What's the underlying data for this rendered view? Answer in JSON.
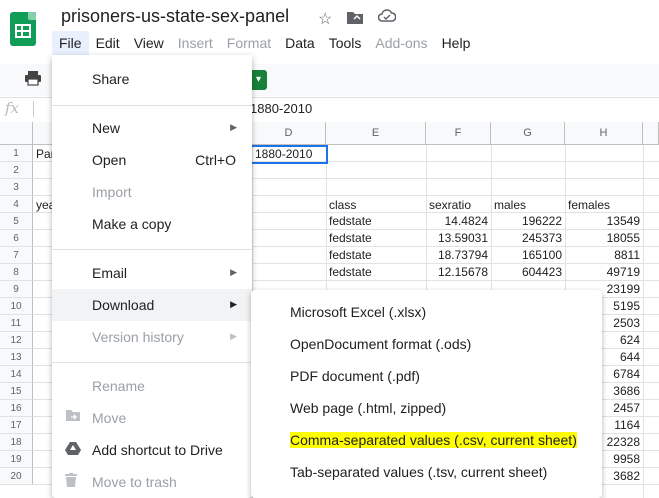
{
  "app": {
    "doc_title": "prisoners-us-state-sex-panel",
    "star_icon": "star-icon",
    "move_icon": "move-to-drive-icon",
    "cloud_icon": "cloud-status-icon"
  },
  "menubar": [
    "File",
    "Edit",
    "View",
    "Insert",
    "Format",
    "Data",
    "Tools",
    "Add-ons",
    "Help"
  ],
  "formula_bar": {
    "fx": "fx",
    "value": "1880-2010"
  },
  "grid": {
    "columns": [
      "",
      "D",
      "E",
      "F",
      "G",
      "H"
    ],
    "rows": [
      "1",
      "2",
      "3",
      "4",
      "5",
      "6",
      "7",
      "8",
      "9",
      "10",
      "11",
      "12",
      "13",
      "14",
      "15",
      "16",
      "17",
      "18",
      "19",
      "20"
    ],
    "a1_text": "Pan",
    "a4_text": "yea",
    "d1_text": "1880-2010",
    "headers": {
      "class": "class",
      "sexratio": "sexratio",
      "males": "males",
      "females": "females"
    },
    "data_rows": [
      {
        "class": "fedstate",
        "sexratio": "14.4824",
        "males": "196222",
        "females": "13549"
      },
      {
        "class": "fedstate",
        "sexratio": "13.59031",
        "males": "245373",
        "females": "18055"
      },
      {
        "class": "fedstate",
        "sexratio": "18.73794",
        "males": "165100",
        "females": "8811"
      },
      {
        "class": "fedstate",
        "sexratio": "12.15678",
        "males": "604423",
        "females": "49719"
      },
      {
        "class": "",
        "sexratio": "",
        "males": "",
        "females": "23199"
      },
      {
        "class": "",
        "sexratio": "",
        "males": "",
        "females": "5195"
      },
      {
        "class": "",
        "sexratio": "",
        "males": "",
        "females": "2503"
      },
      {
        "class": "",
        "sexratio": "",
        "males": "",
        "females": "624"
      },
      {
        "class": "",
        "sexratio": "",
        "males": "",
        "females": "644"
      },
      {
        "class": "",
        "sexratio": "",
        "males": "",
        "females": "6784"
      },
      {
        "class": "",
        "sexratio": "",
        "males": "",
        "females": "3686"
      },
      {
        "class": "",
        "sexratio": "",
        "males": "",
        "females": "2457"
      },
      {
        "class": "",
        "sexratio": "",
        "males": "",
        "females": "1164"
      },
      {
        "class": "",
        "sexratio": "",
        "males": "",
        "females": "22328"
      },
      {
        "class": "",
        "sexratio": "",
        "males": "",
        "females": "9958"
      },
      {
        "class": "",
        "sexratio": "",
        "males": "",
        "females": "3682"
      }
    ]
  },
  "file_menu": {
    "share": "Share",
    "new": "New",
    "open": "Open",
    "open_shortcut": "Ctrl+O",
    "import": "Import",
    "make_copy": "Make a copy",
    "email": "Email",
    "download": "Download",
    "version_history": "Version history",
    "rename": "Rename",
    "move": "Move",
    "add_shortcut": "Add shortcut to Drive",
    "move_trash": "Move to trash"
  },
  "download_menu": {
    "xlsx": "Microsoft Excel (.xlsx)",
    "ods": "OpenDocument format (.ods)",
    "pdf": "PDF document (.pdf)",
    "html": "Web page (.html, zipped)",
    "csv": "Comma-separated values (.csv, current sheet)",
    "tsv": "Tab-separated values (.tsv, current sheet)"
  },
  "colors": {
    "accent": "#1a73e8",
    "brand": "#0f9d58",
    "highlight": "#ffff00"
  }
}
